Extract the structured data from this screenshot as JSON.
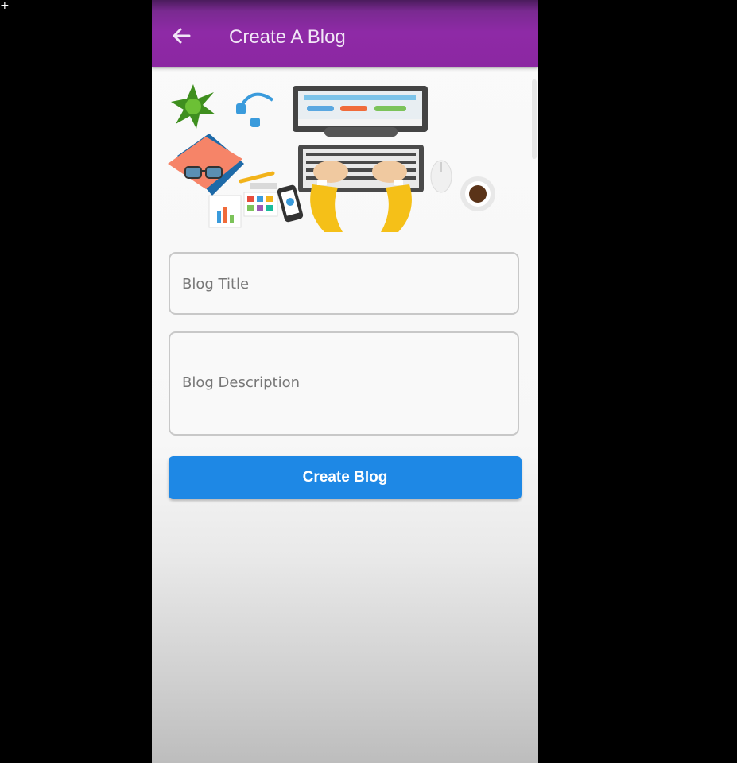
{
  "appbar": {
    "title": "Create A Blog",
    "back_icon": "arrow-left-icon",
    "color": "#8e2aa6"
  },
  "form": {
    "title_placeholder": "Blog Title",
    "description_placeholder": "Blog Description",
    "submit_label": "Create Blog",
    "submit_color": "#1e88e5"
  },
  "illustration": {
    "icon": "workspace-desk-illustration"
  }
}
